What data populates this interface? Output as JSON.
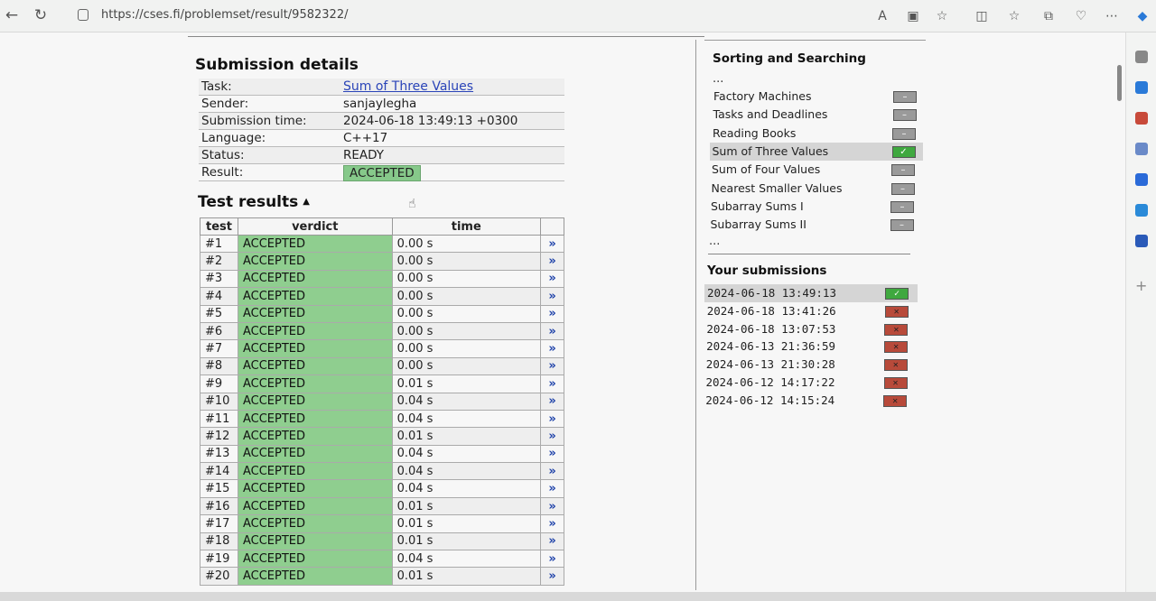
{
  "browser": {
    "url": "https://cses.fi/problemset/result/9582322/"
  },
  "details": {
    "title": "Submission details",
    "rows": [
      {
        "key": "Task:",
        "value": "Sum of Three Values"
      },
      {
        "key": "Sender:",
        "value": "sanjaylegha"
      },
      {
        "key": "Submission time:",
        "value": "2024-06-18 13:49:13 +0300"
      },
      {
        "key": "Language:",
        "value": "C++17"
      },
      {
        "key": "Status:",
        "value": "READY"
      },
      {
        "key": "Result:",
        "value": "ACCEPTED"
      }
    ]
  },
  "tests": {
    "title": "Test results",
    "caret": "▲",
    "headers": {
      "test": "test",
      "verdict": "verdict",
      "time": "time"
    },
    "arrow": "»",
    "rows": [
      {
        "test": "#1",
        "verdict": "ACCEPTED",
        "time": "0.00 s"
      },
      {
        "test": "#2",
        "verdict": "ACCEPTED",
        "time": "0.00 s"
      },
      {
        "test": "#3",
        "verdict": "ACCEPTED",
        "time": "0.00 s"
      },
      {
        "test": "#4",
        "verdict": "ACCEPTED",
        "time": "0.00 s"
      },
      {
        "test": "#5",
        "verdict": "ACCEPTED",
        "time": "0.00 s"
      },
      {
        "test": "#6",
        "verdict": "ACCEPTED",
        "time": "0.00 s"
      },
      {
        "test": "#7",
        "verdict": "ACCEPTED",
        "time": "0.00 s"
      },
      {
        "test": "#8",
        "verdict": "ACCEPTED",
        "time": "0.00 s"
      },
      {
        "test": "#9",
        "verdict": "ACCEPTED",
        "time": "0.01 s"
      },
      {
        "test": "#10",
        "verdict": "ACCEPTED",
        "time": "0.04 s"
      },
      {
        "test": "#11",
        "verdict": "ACCEPTED",
        "time": "0.04 s"
      },
      {
        "test": "#12",
        "verdict": "ACCEPTED",
        "time": "0.01 s"
      },
      {
        "test": "#13",
        "verdict": "ACCEPTED",
        "time": "0.04 s"
      },
      {
        "test": "#14",
        "verdict": "ACCEPTED",
        "time": "0.04 s"
      },
      {
        "test": "#15",
        "verdict": "ACCEPTED",
        "time": "0.04 s"
      },
      {
        "test": "#16",
        "verdict": "ACCEPTED",
        "time": "0.01 s"
      },
      {
        "test": "#17",
        "verdict": "ACCEPTED",
        "time": "0.01 s"
      },
      {
        "test": "#18",
        "verdict": "ACCEPTED",
        "time": "0.01 s"
      },
      {
        "test": "#19",
        "verdict": "ACCEPTED",
        "time": "0.04 s"
      },
      {
        "test": "#20",
        "verdict": "ACCEPTED",
        "time": "0.01 s"
      }
    ]
  },
  "sidebar": {
    "section_title": "Sorting and Searching",
    "ellipsis": "...",
    "tasks": [
      {
        "name": "Factory Machines",
        "status": "unsolved",
        "mark": "–"
      },
      {
        "name": "Tasks and Deadlines",
        "status": "unsolved",
        "mark": "–"
      },
      {
        "name": "Reading Books",
        "status": "unsolved",
        "mark": "–"
      },
      {
        "name": "Sum of Three Values",
        "status": "solved",
        "mark": "✓"
      },
      {
        "name": "Sum of Four Values",
        "status": "unsolved",
        "mark": "–"
      },
      {
        "name": "Nearest Smaller Values",
        "status": "unsolved",
        "mark": "–"
      },
      {
        "name": "Subarray Sums I",
        "status": "unsolved",
        "mark": "–"
      },
      {
        "name": "Subarray Sums II",
        "status": "unsolved",
        "mark": "–"
      }
    ],
    "submissions_title": "Your submissions",
    "submissions": [
      {
        "time": "2024-06-18 13:49:13",
        "result": "accepted",
        "mark": "✓"
      },
      {
        "time": "2024-06-18 13:41:26",
        "result": "failed",
        "mark": "✕"
      },
      {
        "time": "2024-06-18 13:07:53",
        "result": "failed",
        "mark": "✕"
      },
      {
        "time": "2024-06-13 21:36:59",
        "result": "failed",
        "mark": "✕"
      },
      {
        "time": "2024-06-13 21:30:28",
        "result": "failed",
        "mark": "✕"
      },
      {
        "time": "2024-06-12 14:17:22",
        "result": "failed",
        "mark": "✕"
      },
      {
        "time": "2024-06-12 14:15:24",
        "result": "failed",
        "mark": "✕"
      }
    ]
  },
  "colors": {
    "accepted": "#8fce8f",
    "solved": "#3fa83f",
    "failed": "#b84a3a",
    "link": "#2a44b8"
  }
}
